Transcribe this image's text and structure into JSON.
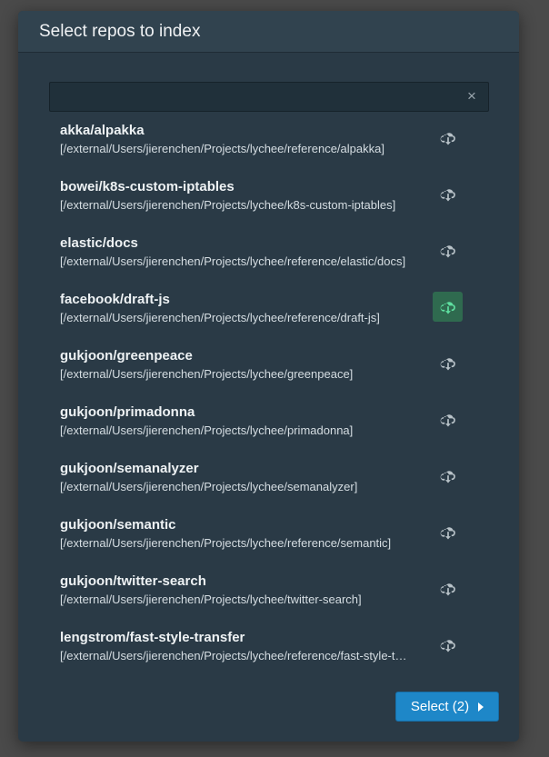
{
  "dialog": {
    "title": "Select repos to index",
    "search": {
      "value": "",
      "placeholder": ""
    },
    "clear_icon": "×",
    "repos": [
      {
        "name": "akka/alpakka",
        "path": "[/external/Users/jierenchen/Projects/lychee/reference/alpakka]",
        "selected": false
      },
      {
        "name": "bowei/k8s-custom-iptables",
        "path": "[/external/Users/jierenchen/Projects/lychee/k8s-custom-iptables]",
        "selected": false
      },
      {
        "name": "elastic/docs",
        "path": "[/external/Users/jierenchen/Projects/lychee/reference/elastic/docs]",
        "selected": false
      },
      {
        "name": "facebook/draft-js",
        "path": "[/external/Users/jierenchen/Projects/lychee/reference/draft-js]",
        "selected": true
      },
      {
        "name": "gukjoon/greenpeace",
        "path": "[/external/Users/jierenchen/Projects/lychee/greenpeace]",
        "selected": false
      },
      {
        "name": "gukjoon/primadonna",
        "path": "[/external/Users/jierenchen/Projects/lychee/primadonna]",
        "selected": false
      },
      {
        "name": "gukjoon/semanalyzer",
        "path": "[/external/Users/jierenchen/Projects/lychee/semanalyzer]",
        "selected": false
      },
      {
        "name": "gukjoon/semantic",
        "path": "[/external/Users/jierenchen/Projects/lychee/reference/semantic]",
        "selected": false
      },
      {
        "name": "gukjoon/twitter-search",
        "path": "[/external/Users/jierenchen/Projects/lychee/twitter-search]",
        "selected": false
      },
      {
        "name": "lengstrom/fast-style-transfer",
        "path": "[/external/Users/jierenchen/Projects/lychee/reference/fast-style-transfer]",
        "selected": false
      }
    ],
    "index_icon": "cloud-download-icon",
    "select_button_label": "Select (2)",
    "colors": {
      "background": "#4a4a4a",
      "dialog": "#2a3a46",
      "header": "#31434f",
      "icon_default": "#b8c2c8",
      "icon_selected_bg": "#2f6a4f",
      "icon_selected": "#5ee0a0",
      "primary_button": "#1e87c8"
    }
  }
}
